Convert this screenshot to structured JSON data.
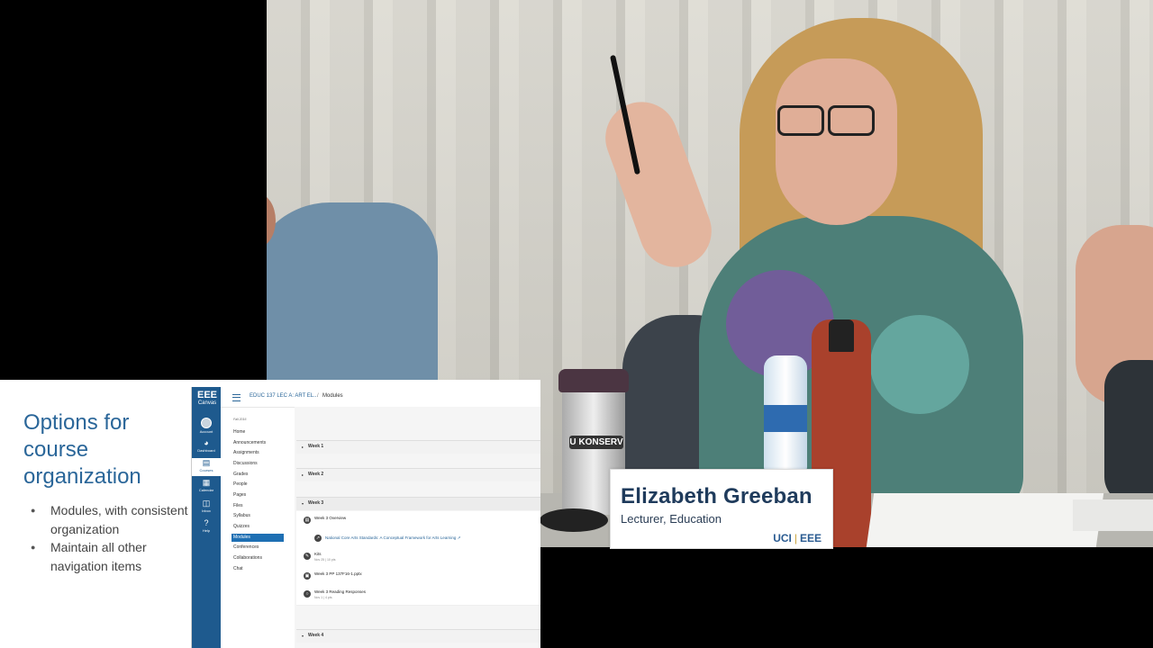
{
  "nameplate": {
    "name": "Elizabeth Greeban",
    "title": "Lecturer, Education",
    "logo_left": "UCI",
    "logo_sep": "|",
    "logo_right": "EEE"
  },
  "video": {
    "tumbler_text": "U KONSERV"
  },
  "slide": {
    "title": "Options for course organization",
    "bullets": [
      "Modules, with consistent organization",
      "Maintain all other navigation items"
    ]
  },
  "lms": {
    "brand": "EEE",
    "brand_sub": "Canvas",
    "global_nav": [
      {
        "label": "Account",
        "icon": "avatar-icon"
      },
      {
        "label": "Dashboard",
        "icon": "dashboard-icon"
      },
      {
        "label": "Courses",
        "icon": "book-icon"
      },
      {
        "label": "Calendar",
        "icon": "calendar-icon"
      },
      {
        "label": "Inbox",
        "icon": "inbox-icon"
      },
      {
        "label": "Help",
        "icon": "help-icon"
      }
    ],
    "breadcrumb": {
      "course": "EDUC 137 LEC A: ART EL...",
      "separator": "/",
      "page": "Modules"
    },
    "term": "Fall 2016",
    "course_nav": [
      "Home",
      "Announcements",
      "Assignments",
      "Discussions",
      "Grades",
      "People",
      "Pages",
      "Files",
      "Syllabus",
      "Quizzes",
      "Modules",
      "Conferences",
      "Collaborations",
      "Chat"
    ],
    "course_nav_active": "Modules",
    "modules": [
      {
        "title": "Week 1",
        "caret": "▸"
      },
      {
        "title": "Week 2",
        "caret": "▸"
      },
      {
        "title": "Week 3",
        "caret": "▾"
      },
      {
        "title": "Week 4",
        "caret": "▾"
      }
    ],
    "week3_items": [
      {
        "title": "Week 3 Overview",
        "meta": ""
      },
      {
        "title": "National Core Arts Standards: A Conceptual Framework for Arts Learning ↗",
        "meta": ""
      },
      {
        "title": "Kits",
        "meta": "Nov 25 | 10 pts"
      },
      {
        "title": "Week 3 PP 137F16-1.pptx",
        "meta": ""
      },
      {
        "title": "Week 3 Reading Responses",
        "meta": "Nov 1 | 4 pts"
      }
    ]
  }
}
